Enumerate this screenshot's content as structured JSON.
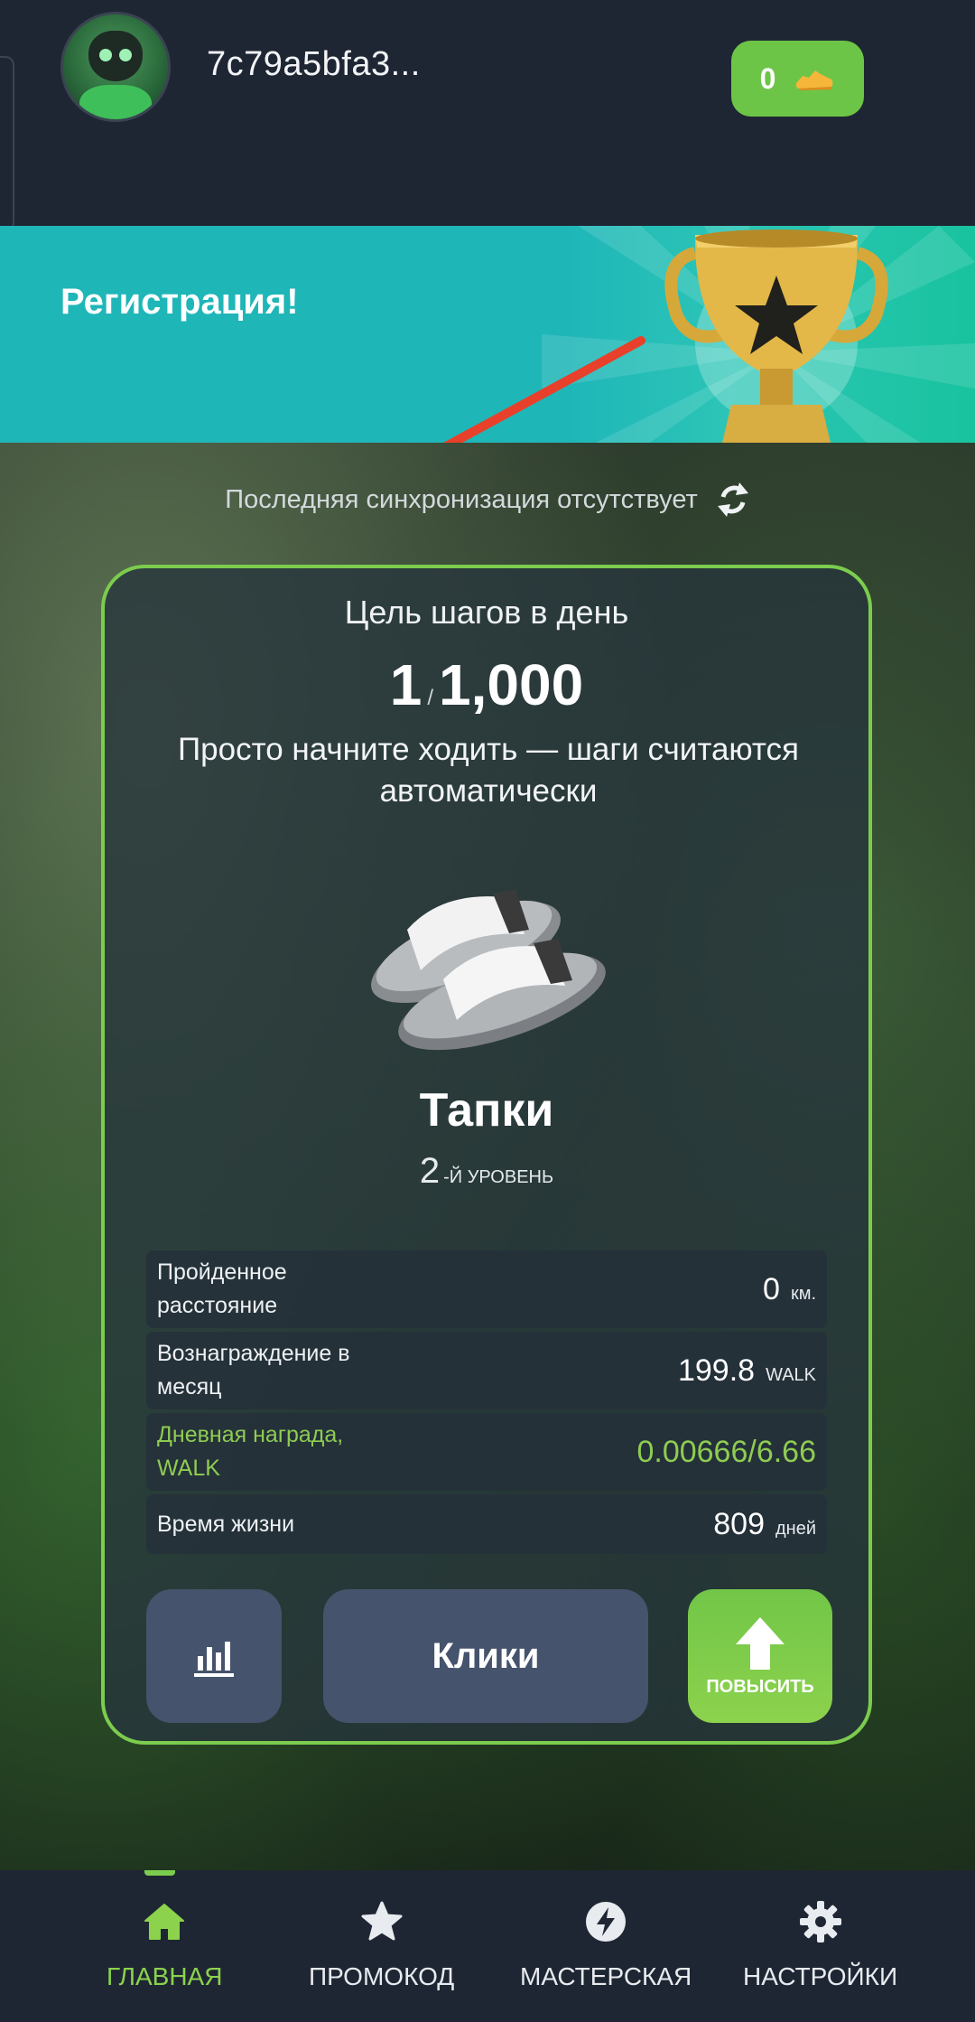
{
  "header": {
    "username": "7c79a5bfa3...",
    "balance": "0",
    "balance_icon": "sneaker-icon"
  },
  "banner": {
    "title": "Регистрация!"
  },
  "sync": {
    "text": "Последняя синхронизация отсутствует",
    "icon": "sync-icon"
  },
  "card": {
    "title": "Цель шагов в день",
    "steps_current": "1",
    "steps_separator": "/",
    "steps_goal": "1,000",
    "subtitle": "Просто начните ходить — шаги считаются автоматически",
    "item_name": "Тапки",
    "level_number": "2",
    "level_label": "-Й УРОВЕНЬ",
    "stats": [
      {
        "label": "Пройденное расстояние",
        "value": "0",
        "unit": "км."
      },
      {
        "label": "Вознаграждение в месяц",
        "value": "199.8",
        "unit": "WALK"
      },
      {
        "label": "Дневная награда, WALK",
        "value": "0.00666/6.66",
        "unit": ""
      },
      {
        "label": "Время жизни",
        "value": "809",
        "unit": "дней"
      }
    ],
    "buttons": {
      "clicks_label": "Клики",
      "upgrade_label": "ПОВЫСИТЬ"
    }
  },
  "nav": [
    {
      "label": "ГЛАВНАЯ",
      "icon": "home-icon",
      "active": true
    },
    {
      "label": "ПРОМОКОД",
      "icon": "star-icon",
      "active": false
    },
    {
      "label": "МАСТЕРСКАЯ",
      "icon": "lightning-icon",
      "active": false
    },
    {
      "label": "НАСТРОЙКИ",
      "icon": "gear-icon",
      "active": false
    }
  ],
  "colors": {
    "accent_green": "#7ccc4e",
    "banner_teal": "#1fb6b8",
    "annotation_red": "#e8402a",
    "background": "#1f2633"
  }
}
